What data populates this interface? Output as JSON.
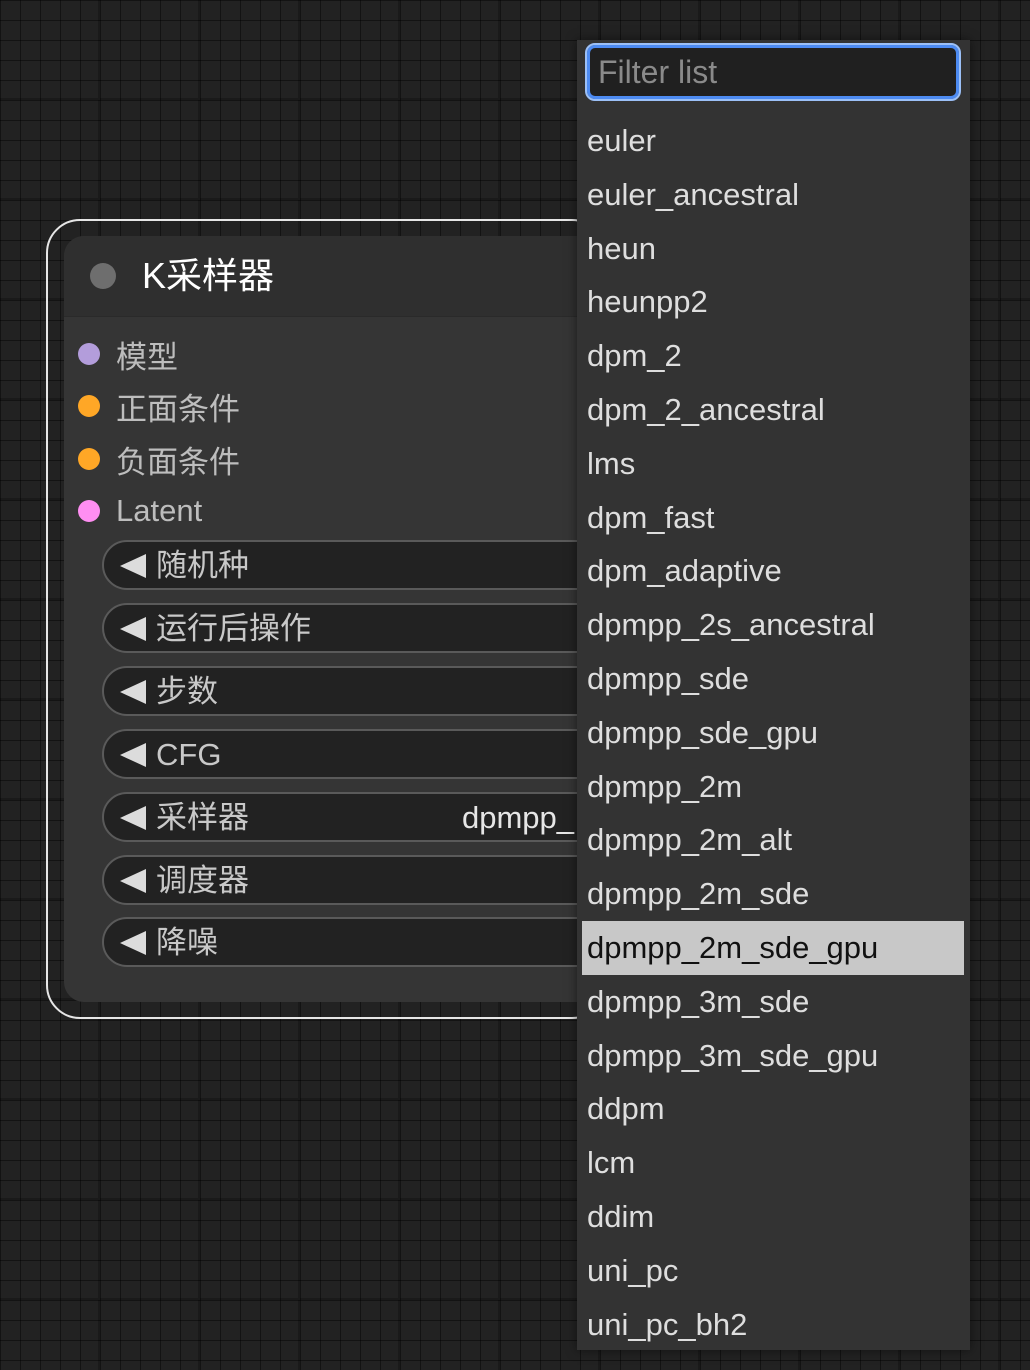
{
  "node": {
    "title": "K采样器",
    "inputs": [
      {
        "label": "模型",
        "color": "#b39ddb"
      },
      {
        "label": "正面条件",
        "color": "#ffa726"
      },
      {
        "label": "负面条件",
        "color": "#ffa726"
      },
      {
        "label": "Latent",
        "color": "#ff8ef2"
      }
    ],
    "widgets": [
      {
        "label": "随机种",
        "value": ""
      },
      {
        "label": "运行后操作",
        "value": ""
      },
      {
        "label": "步数",
        "value": ""
      },
      {
        "label": "CFG",
        "value": ""
      },
      {
        "label": "采样器",
        "value": "dpmpp_"
      },
      {
        "label": "调度器",
        "value": ""
      },
      {
        "label": "降噪",
        "value": ""
      }
    ]
  },
  "dropdown": {
    "filter_placeholder": "Filter list",
    "filter_value": "",
    "selected": "dpmpp_2m_sde_gpu",
    "options": [
      "euler",
      "euler_ancestral",
      "heun",
      "heunpp2",
      "dpm_2",
      "dpm_2_ancestral",
      "lms",
      "dpm_fast",
      "dpm_adaptive",
      "dpmpp_2s_ancestral",
      "dpmpp_sde",
      "dpmpp_sde_gpu",
      "dpmpp_2m",
      "dpmpp_2m_alt",
      "dpmpp_2m_sde",
      "dpmpp_2m_sde_gpu",
      "dpmpp_3m_sde",
      "dpmpp_3m_sde_gpu",
      "ddpm",
      "lcm",
      "ddim",
      "uni_pc",
      "uni_pc_bh2"
    ]
  }
}
